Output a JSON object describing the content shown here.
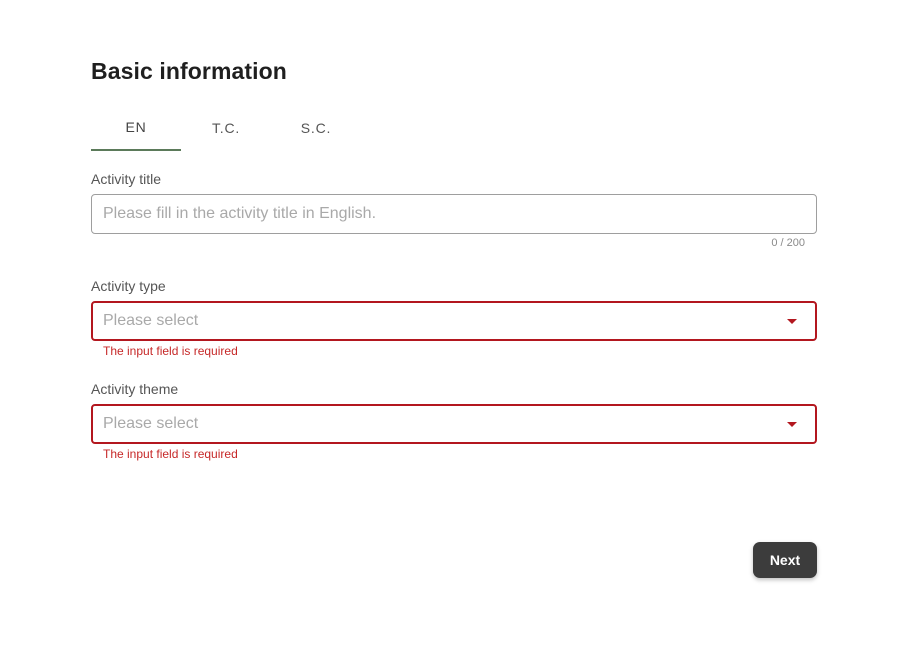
{
  "form": {
    "title": "Basic information",
    "tabs": [
      {
        "label": "EN",
        "active": true
      },
      {
        "label": "T.C.",
        "active": false
      },
      {
        "label": "S.C.",
        "active": false
      }
    ],
    "activity_title": {
      "label": "Activity title",
      "placeholder": "Please fill in the activity title in English.",
      "value": "",
      "counter": "0 / 200"
    },
    "activity_type": {
      "label": "Activity type",
      "placeholder": "Please select",
      "error": "The input field is required"
    },
    "activity_theme": {
      "label": "Activity theme",
      "placeholder": "Please select",
      "error": "The input field is required"
    },
    "next_label": "Next"
  },
  "colors": {
    "tab_underline": "#5b7a5a",
    "error": "#b3171f",
    "button_bg": "#3c3c3c"
  },
  "icons": {
    "select_caret": "caret-down-icon"
  }
}
